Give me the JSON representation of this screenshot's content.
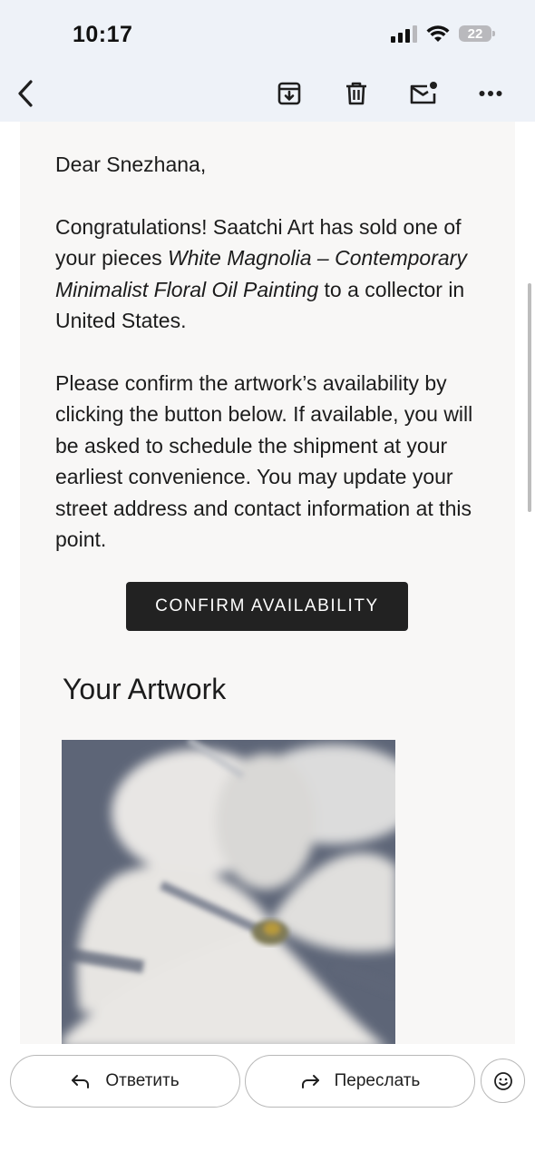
{
  "status_bar": {
    "time": "10:17",
    "battery": "22"
  },
  "toolbar": {
    "back_icon": "chevron-left-icon",
    "actions": [
      "archive-icon",
      "trash-icon",
      "mark-unread-icon",
      "more-icon"
    ]
  },
  "email": {
    "greeting": "Dear Snezhana,",
    "p1_before": "Congratulations! Saatchi Art has sold one of your pieces ",
    "artwork_name": "White Magnolia – Contemporary Minimalist Floral Oil Painting",
    "p1_after": " to a collector in United States.",
    "p2": "Please confirm the artwork’s availability by clicking the button below. If available, you will be asked to schedule the shipment at your earliest convenience. You may update your street address and contact information at this point.",
    "cta_label": "CONFIRM AVAILABILITY",
    "artwork_section_title": "Your Artwork"
  },
  "bottom_bar": {
    "reply_label": "Ответить",
    "forward_label": "Переслать",
    "emoji_icon": "emoji-icon"
  },
  "colors": {
    "topbar": "#eef2f8",
    "sheet": "#f8f7f6",
    "cta": "#222222"
  }
}
